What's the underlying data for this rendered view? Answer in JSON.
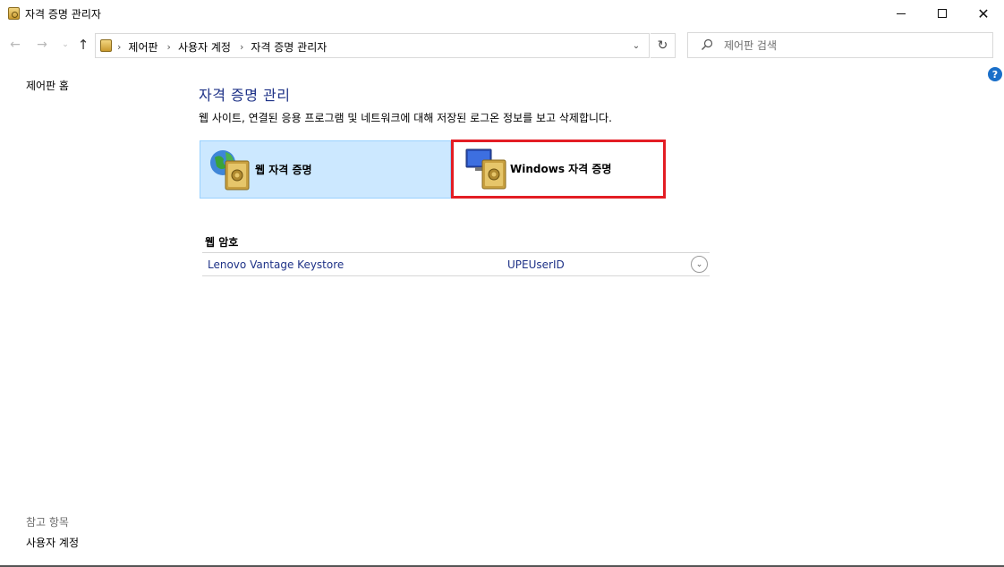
{
  "window": {
    "title": "자격 증명 관리자",
    "minimize_label": "",
    "maximize_label": "",
    "close_label": "✕"
  },
  "nav": {
    "back_glyph": "←",
    "forward_glyph": "→",
    "recent_glyph": "⌄",
    "up_glyph": "↑",
    "refresh_glyph": "↻",
    "dropdown_glyph": "⌄"
  },
  "address": {
    "breadcrumbs": [
      "제어판",
      "사용자 계정",
      "자격 증명 관리자"
    ],
    "separator": "›"
  },
  "search": {
    "placeholder": "제어판 검색"
  },
  "help": {
    "glyph": "?"
  },
  "left_pane": {
    "home_link": "제어판 홈",
    "see_also_heading": "참고 항목",
    "see_also_link": "사용자 계정"
  },
  "main": {
    "title": "자격 증명 관리",
    "description": "웹 사이트, 연결된 응용 프로그램 및 네트워크에 대해 저장된 로그온 정보를 보고 삭제합니다.",
    "tabs": [
      {
        "label": "웹 자격 증명",
        "selected": true,
        "icon": "globe-vault-icon"
      },
      {
        "label": "Windows 자격 증명",
        "selected": false,
        "icon": "monitor-vault-icon"
      }
    ],
    "section_title": "웹 암호",
    "credentials": [
      {
        "name": "Lenovo Vantage Keystore",
        "user": "UPEUserID",
        "expand_glyph": "⌄"
      }
    ]
  },
  "colors": {
    "selected_tile_bg": "#cce8ff",
    "selected_tile_border": "#99d1ff",
    "link_blue": "#1e3287",
    "highlight_red": "#e31d24",
    "help_blue": "#1a6fc9"
  }
}
